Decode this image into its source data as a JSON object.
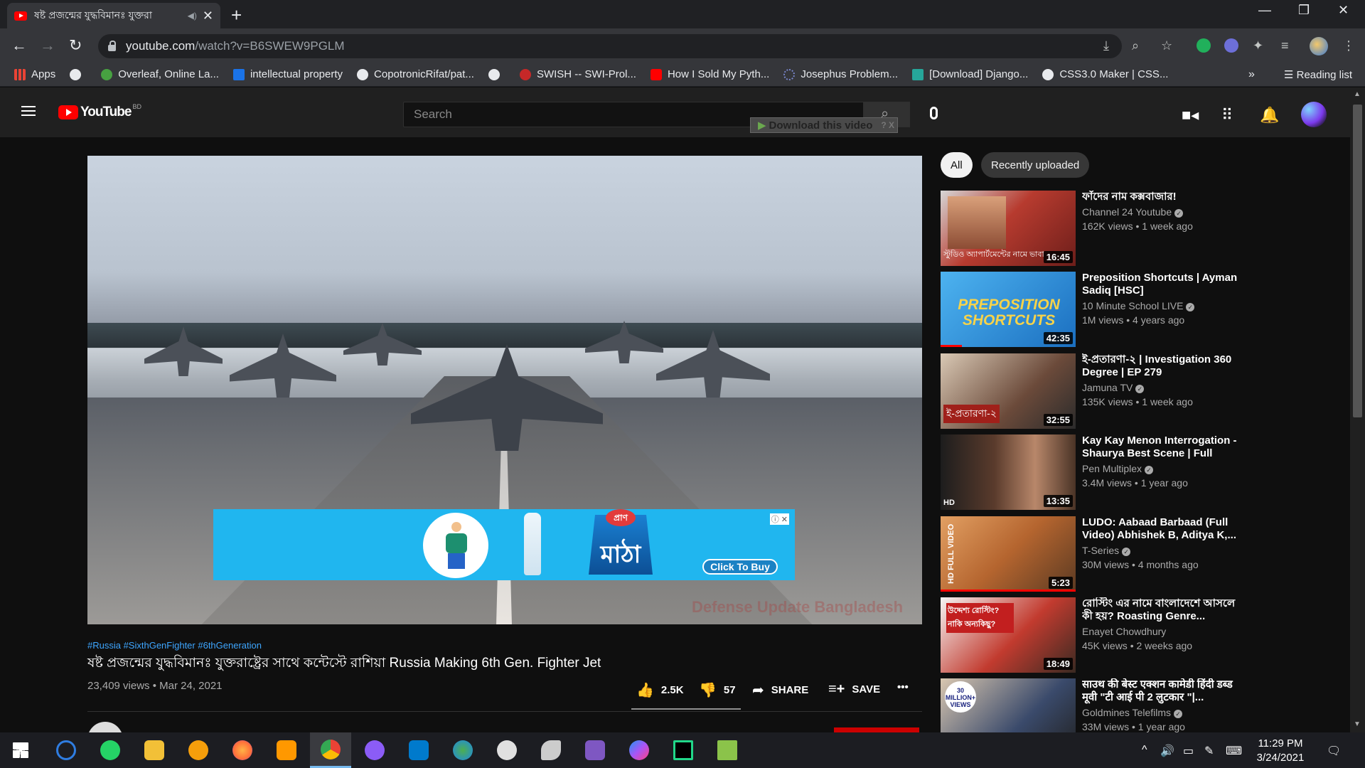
{
  "browser": {
    "tab_title": "ষষ্ট প্রজন্মের যুদ্ধবিমানঃ যুক্তরা",
    "url_domain": "youtube.com",
    "url_path": "/watch?v=B6SWEW9PGLM",
    "reading_list": "Reading list",
    "bookmarks": [
      {
        "label": "Apps",
        "color": "#ea4335"
      },
      {
        "label": "",
        "color": "#e8eaed"
      },
      {
        "label": "Overleaf, Online La...",
        "color": "#47a141"
      },
      {
        "label": "intellectual property",
        "color": "#1a73e8"
      },
      {
        "label": "CopotronicRifat/pat...",
        "color": "#e8eaed"
      },
      {
        "label": "",
        "color": "#e8eaed"
      },
      {
        "label": "SWISH -- SWI-Prol...",
        "color": "#c62828"
      },
      {
        "label": "How I Sold My Pyth...",
        "color": "#ff0000"
      },
      {
        "label": "Josephus Problem...",
        "color": "#3949ab"
      },
      {
        "label": "[Download] Django...",
        "color": "#26a69a"
      },
      {
        "label": "CSS3.0 Maker | CSS...",
        "color": "#e8eaed"
      }
    ],
    "more_bookmarks": "»"
  },
  "youtube": {
    "country_code": "BD",
    "search_placeholder": "Search",
    "download_ext_label": "Download this video",
    "download_ext_extra": "? X",
    "chips": [
      "All",
      "Recently uploaded"
    ]
  },
  "video": {
    "hashtags": "#Russia #SixthGenFighter #6thGeneration",
    "title": "ষষ্ট প্রজন্মের যুদ্ধবিমানঃ যুক্তরাষ্ট্রের সাথে কন্টেস্টে রাশিয়া Russia Making 6th Gen. Fighter Jet",
    "views_date": "23,409 views • Mar 24, 2021",
    "likes": "2.5K",
    "dislikes": "57",
    "share": "SHARE",
    "save": "SAVE",
    "more": "•••",
    "watermark": "Defense Update Bangladesh",
    "ad": {
      "brand_top": "প্রাণ",
      "brand_name": "মাঠা",
      "cta": "Click To Buy",
      "badge": "ⓘ ✕"
    }
  },
  "suggested": [
    {
      "title": "ফাঁদের নাম কক্সবাজার!",
      "channel": "Channel 24 Youtube",
      "meta": "162K views • 1 week ago",
      "duration": "16:45",
      "thumb_text": "স্টুডিও অ্যাপার্টমেন্টের নামে ভাবা",
      "thumb_color": "#8b2f2a"
    },
    {
      "title": "Preposition Shortcuts | Ayman Sadiq [HSC]",
      "channel": "10 Minute School LIVE",
      "meta": "1M views • 4 years ago",
      "duration": "42:35",
      "thumb_text": "PREPOSITION SHORTCUTS",
      "thumb_color": "#2f8fd8"
    },
    {
      "title": "ই-প্রতারণা-২ | Investigation 360 Degree | EP 279",
      "channel": "Jamuna TV",
      "meta": "135K views • 1 week ago",
      "duration": "32:55",
      "thumb_text": "ই-প্রতারণা-২",
      "thumb_color": "#6b4a3a"
    },
    {
      "title": "Kay Kay Menon Interrogation - Shaurya Best Scene | Full Hind...",
      "channel": "Pen Multiplex",
      "meta": "3.4M views • 1 year ago",
      "duration": "13:35",
      "thumb_text": "HD",
      "thumb_color": "#5a3b2c"
    },
    {
      "title": "LUDO: Aabaad Barbaad (Full Video) Abhishek B, Aditya K,...",
      "channel": "T-Series",
      "meta": "30M views • 4 months ago",
      "duration": "5:23",
      "thumb_text": "HD FULL VIDEO",
      "thumb_color": "#b5652f"
    },
    {
      "title": "রোস্টিং এর নামে বাংলাদেশে আসলে কী হয়? Roasting Genre...",
      "channel": "Enayet Chowdhury",
      "meta": "45K views • 2 weeks ago",
      "duration": "18:49",
      "thumb_text": "উদ্দেশ্য রোস্টিং? নাকি অন্যকিছু?",
      "thumb_color": "#c23b2f"
    },
    {
      "title": "साउथ की बेस्ट एक्शन कामेडी हिंदी डब्ड मूवी \"टी आई पी 2 लुटकार \"|...",
      "channel": "Goldmines Telefilms",
      "meta": "33M views • 1 year ago",
      "duration": "",
      "thumb_text": "30 MILLION+ VIEWS",
      "thumb_color": "#3a4a6b"
    }
  ],
  "taskbar": {
    "time": "11:29 PM",
    "date": "3/24/2021",
    "apps": [
      {
        "name": "start",
        "color": "#ffffff"
      },
      {
        "name": "refresh",
        "color": "#2f7de1"
      },
      {
        "name": "whatsapp",
        "color": "#25d366"
      },
      {
        "name": "files",
        "color": "#f2c037"
      },
      {
        "name": "brave",
        "color": "#f59e0b"
      },
      {
        "name": "firefox",
        "color": "#ff7139"
      },
      {
        "name": "sublime",
        "color": "#ff9800"
      },
      {
        "name": "chrome",
        "color": "#4285f4"
      },
      {
        "name": "github",
        "color": "#8b5cf6"
      },
      {
        "name": "vscode",
        "color": "#007acc"
      },
      {
        "name": "globe",
        "color": "#4caf50"
      },
      {
        "name": "paint",
        "color": "#e0e0e0"
      },
      {
        "name": "satellite",
        "color": "#cccccc"
      },
      {
        "name": "visualstudio",
        "color": "#7e57c2"
      },
      {
        "name": "messenger",
        "color": "#a855f7"
      },
      {
        "name": "pycharm",
        "color": "#21d789"
      },
      {
        "name": "excel",
        "color": "#8bc34a"
      }
    ]
  }
}
